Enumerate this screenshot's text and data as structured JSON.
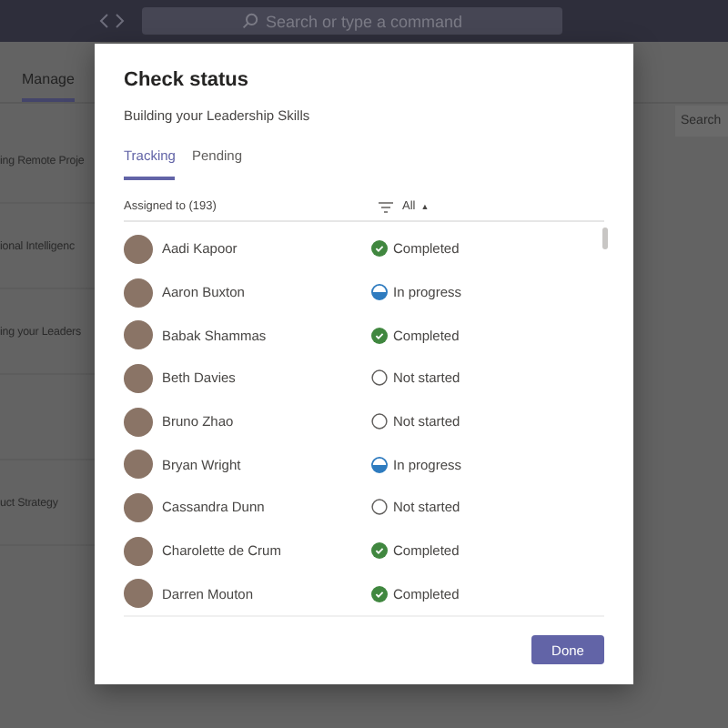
{
  "app_bar": {
    "search": {
      "placeholder": "Search or type a command"
    }
  },
  "page": {
    "tab": {
      "label": "Manage",
      "selected": true
    },
    "search": {
      "placeholder": "Search"
    },
    "items": [
      {
        "title": "ing Remote Proje"
      },
      {
        "title": "ional Intelligenc"
      },
      {
        "title": "ing your Leaders"
      },
      {
        "title": "uct Strategy"
      }
    ]
  },
  "dialog": {
    "title": "Check status",
    "subtitle": "Building your Leadership Skills",
    "tabs": [
      {
        "label": "Tracking",
        "selected": true
      },
      {
        "label": "Pending",
        "selected": false
      }
    ],
    "list_header": {
      "assigned": "Assigned to (193)",
      "filter": "All",
      "sort_marker": "▲"
    },
    "rows": [
      {
        "name": "Aadi Kapoor",
        "status": "Completed",
        "kind": "completed"
      },
      {
        "name": "Aaron Buxton",
        "status": "In progress",
        "kind": "in_progress"
      },
      {
        "name": "Babak Shammas",
        "status": "Completed",
        "kind": "completed"
      },
      {
        "name": "Beth Davies",
        "status": "Not started",
        "kind": "not_started"
      },
      {
        "name": "Bruno Zhao",
        "status": "Not started",
        "kind": "not_started"
      },
      {
        "name": "Bryan Wright",
        "status": "In progress",
        "kind": "in_progress"
      },
      {
        "name": "Cassandra Dunn",
        "status": "Not started",
        "kind": "not_started"
      },
      {
        "name": "Charolette de Crum",
        "status": "Completed",
        "kind": "completed"
      },
      {
        "name": "Darren Mouton",
        "status": "Completed",
        "kind": "completed"
      }
    ],
    "done_button": "Done"
  }
}
